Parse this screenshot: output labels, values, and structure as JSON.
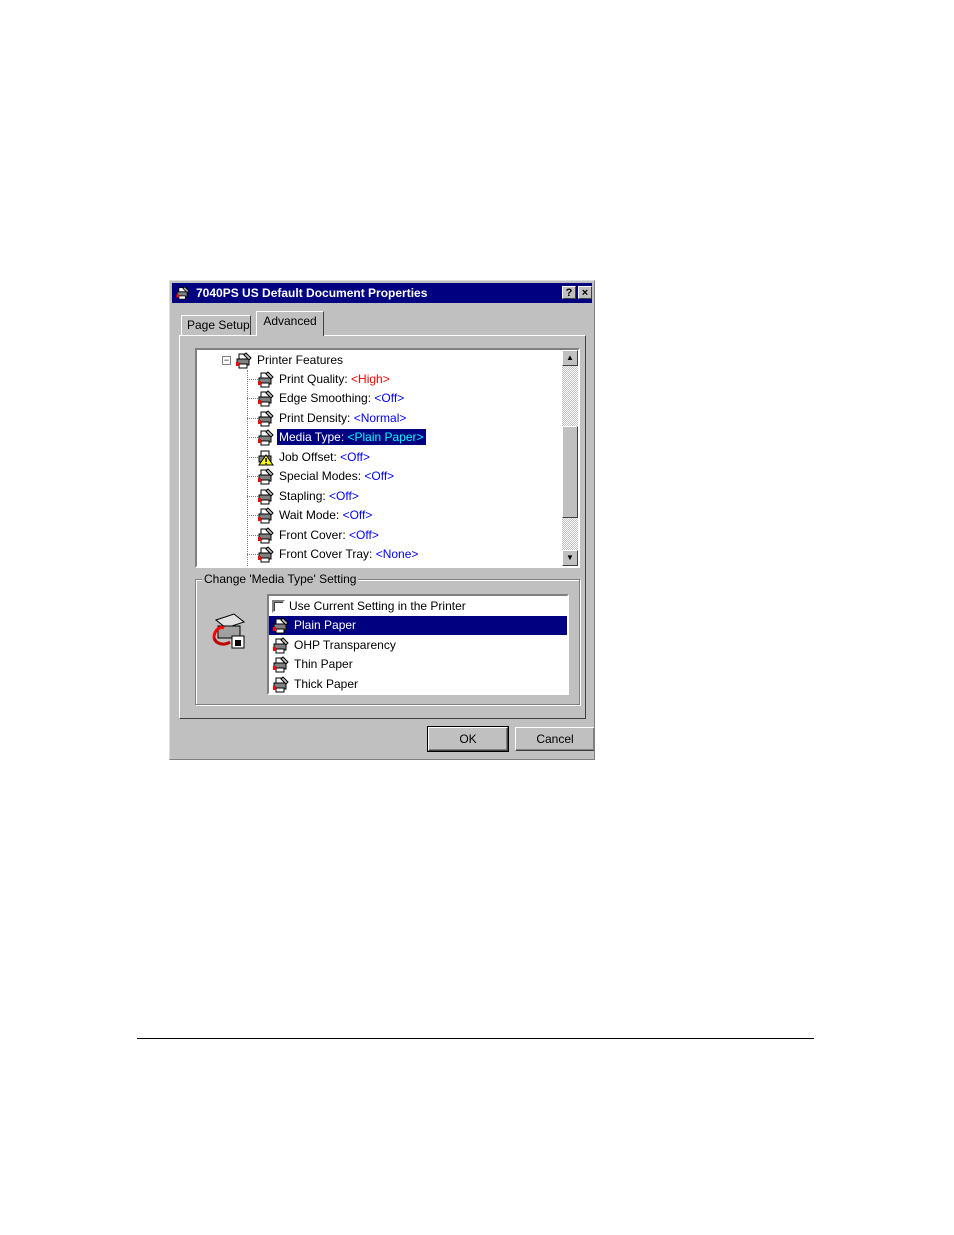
{
  "dialog": {
    "title": "7040PS US Default Document Properties",
    "help_label": "?",
    "close_label": "×"
  },
  "tabs": [
    {
      "label": "Page Setup"
    },
    {
      "label": "Advanced"
    }
  ],
  "tree": {
    "root_label": "Printer Features",
    "expander_label": "−",
    "items": [
      {
        "label": "Print Quality: ",
        "value": "<High>",
        "icon": "printer-settings-icon"
      },
      {
        "label": "Edge Smoothing: ",
        "value": "<Off>",
        "icon": "printer-settings-icon"
      },
      {
        "label": "Print Density: ",
        "value": "<Normal>",
        "icon": "printer-settings-icon"
      },
      {
        "label": "Media Type: ",
        "value": "<Plain Paper>",
        "icon": "printer-settings-icon"
      },
      {
        "label": "Job Offset: ",
        "value": "<Off>",
        "icon": "warning-icon"
      },
      {
        "label": "Special Modes: ",
        "value": "<Off>",
        "icon": "printer-settings-icon"
      },
      {
        "label": "Stapling: ",
        "value": "<Off>",
        "icon": "printer-settings-icon"
      },
      {
        "label": "Wait Mode: ",
        "value": "<Off>",
        "icon": "printer-settings-icon"
      },
      {
        "label": "Front Cover: ",
        "value": "<Off>",
        "icon": "printer-settings-icon"
      },
      {
        "label": "Front Cover Tray: ",
        "value": "<None>",
        "icon": "printer-settings-icon"
      }
    ],
    "selected_index": 3
  },
  "scroll": {
    "up_label": "▲",
    "down_label": "▼"
  },
  "setting_group": {
    "label": "Change 'Media Type' Setting",
    "options": [
      {
        "label": "Use Current Setting in the Printer"
      },
      {
        "label": "Plain Paper"
      },
      {
        "label": "OHP Transparency"
      },
      {
        "label": "Thin Paper"
      },
      {
        "label": "Thick Paper"
      }
    ],
    "selected_index": 1
  },
  "buttons": {
    "ok_label": "OK",
    "cancel_label": "Cancel"
  },
  "colors": {
    "title_bar": "#000080",
    "selection": "#000080",
    "value_red": "#ff0000",
    "value_blue": "#0000ff"
  }
}
